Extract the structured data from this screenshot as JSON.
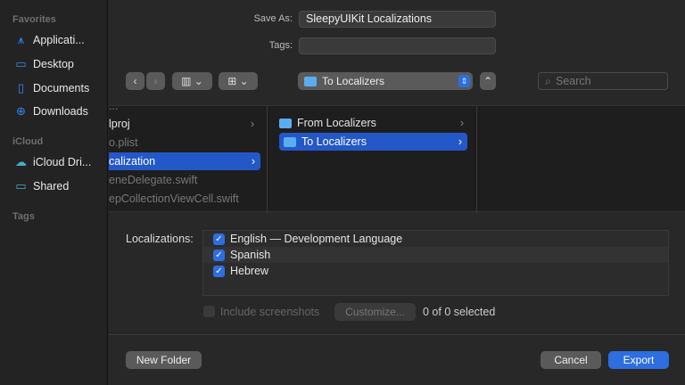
{
  "sidebar": {
    "favorites": "Favorites",
    "items": [
      {
        "label": "Applicati...",
        "icon": "applications-icon"
      },
      {
        "label": "Desktop",
        "icon": "desktop-icon"
      },
      {
        "label": "Documents",
        "icon": "document-icon"
      },
      {
        "label": "Downloads",
        "icon": "downloads-icon"
      }
    ],
    "icloud": "iCloud",
    "icloud_items": [
      {
        "label": "iCloud Dri...",
        "icon": "cloud-icon"
      },
      {
        "label": "Shared",
        "icon": "shared-folder-icon"
      }
    ],
    "tags": "Tags"
  },
  "form": {
    "save_as_label": "Save As:",
    "save_as_value": "SleepyUIKit Localizations",
    "tags_label": "Tags:",
    "tags_value": ""
  },
  "toolbar": {
    "location": "To Localizers",
    "search_placeholder": "Search"
  },
  "browser": {
    "col1": [
      {
        "label": "...",
        "dim": true
      },
      {
        "label": "lproj",
        "chev": true
      },
      {
        "label": "o.plist",
        "dim": true
      },
      {
        "label": "calization",
        "chev": true,
        "selected": true
      },
      {
        "label": "eneDelegate.swift",
        "dim": true
      },
      {
        "label": "epCollectionViewCell.swift",
        "dim": true
      }
    ],
    "col2": [
      {
        "label": "From Localizers"
      },
      {
        "label": "To Localizers",
        "selected": true
      }
    ]
  },
  "localizations": {
    "label": "Localizations:",
    "items": [
      "English — Development Language",
      "Spanish",
      "Hebrew"
    ]
  },
  "options": {
    "include_screenshots": "Include screenshots",
    "customize": "Customize...",
    "selected_count": "0 of 0 selected"
  },
  "footer": {
    "new_folder": "New Folder",
    "cancel": "Cancel",
    "export": "Export"
  }
}
